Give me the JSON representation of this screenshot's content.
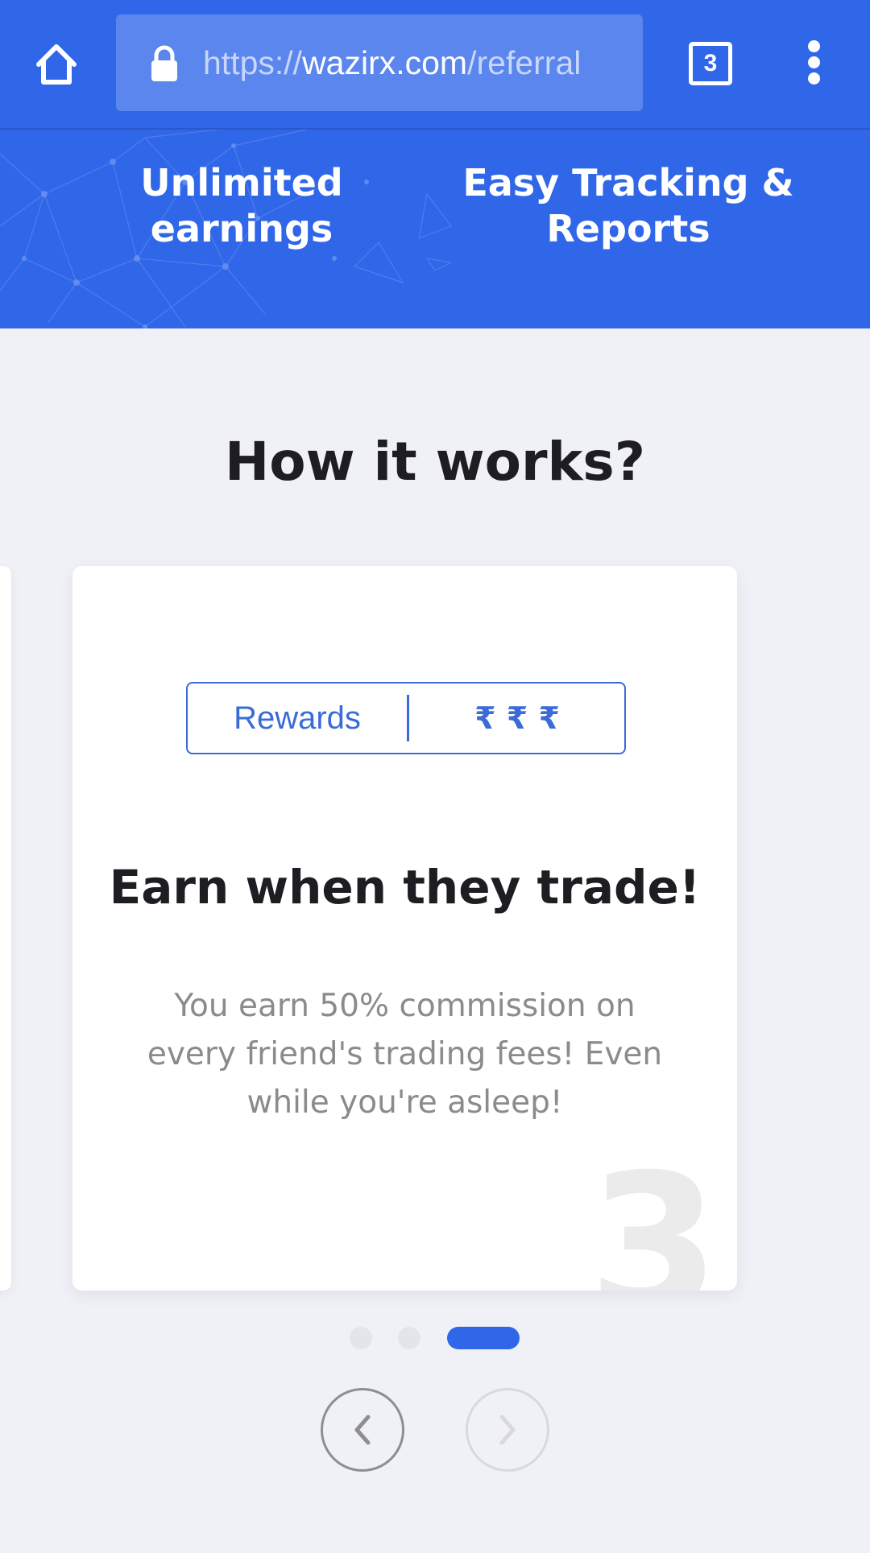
{
  "browser": {
    "url_scheme": "https://",
    "url_host": "wazirx.com",
    "url_path": "/referral",
    "tab_count": "3"
  },
  "hero": {
    "features": [
      {
        "line1": "Unlimited",
        "line2": "earnings"
      },
      {
        "line1": "Easy Tracking &",
        "line2": "Reports"
      }
    ]
  },
  "how_it_works": {
    "title": "How it works?",
    "card": {
      "rewards_label": "Rewards",
      "rewards_value": "₹ ₹ ₹",
      "title": "Earn when they trade!",
      "description_lines": [
        "You earn 50% commission on",
        "every friend's trading fees! Even",
        "while you're asleep!"
      ],
      "step_number": "3"
    },
    "pagination": {
      "total": 3,
      "active_index": 2
    }
  },
  "colors": {
    "brand_blue": "#3066e8",
    "page_background": "#f0f1f6",
    "accent_text": "#3a6bd6"
  },
  "icons": {
    "home": "home-icon",
    "lock": "lock-icon",
    "tabs": "tabs-counter-icon",
    "menu": "more-vert-icon",
    "prev": "chevron-left-icon",
    "next": "chevron-right-icon"
  }
}
